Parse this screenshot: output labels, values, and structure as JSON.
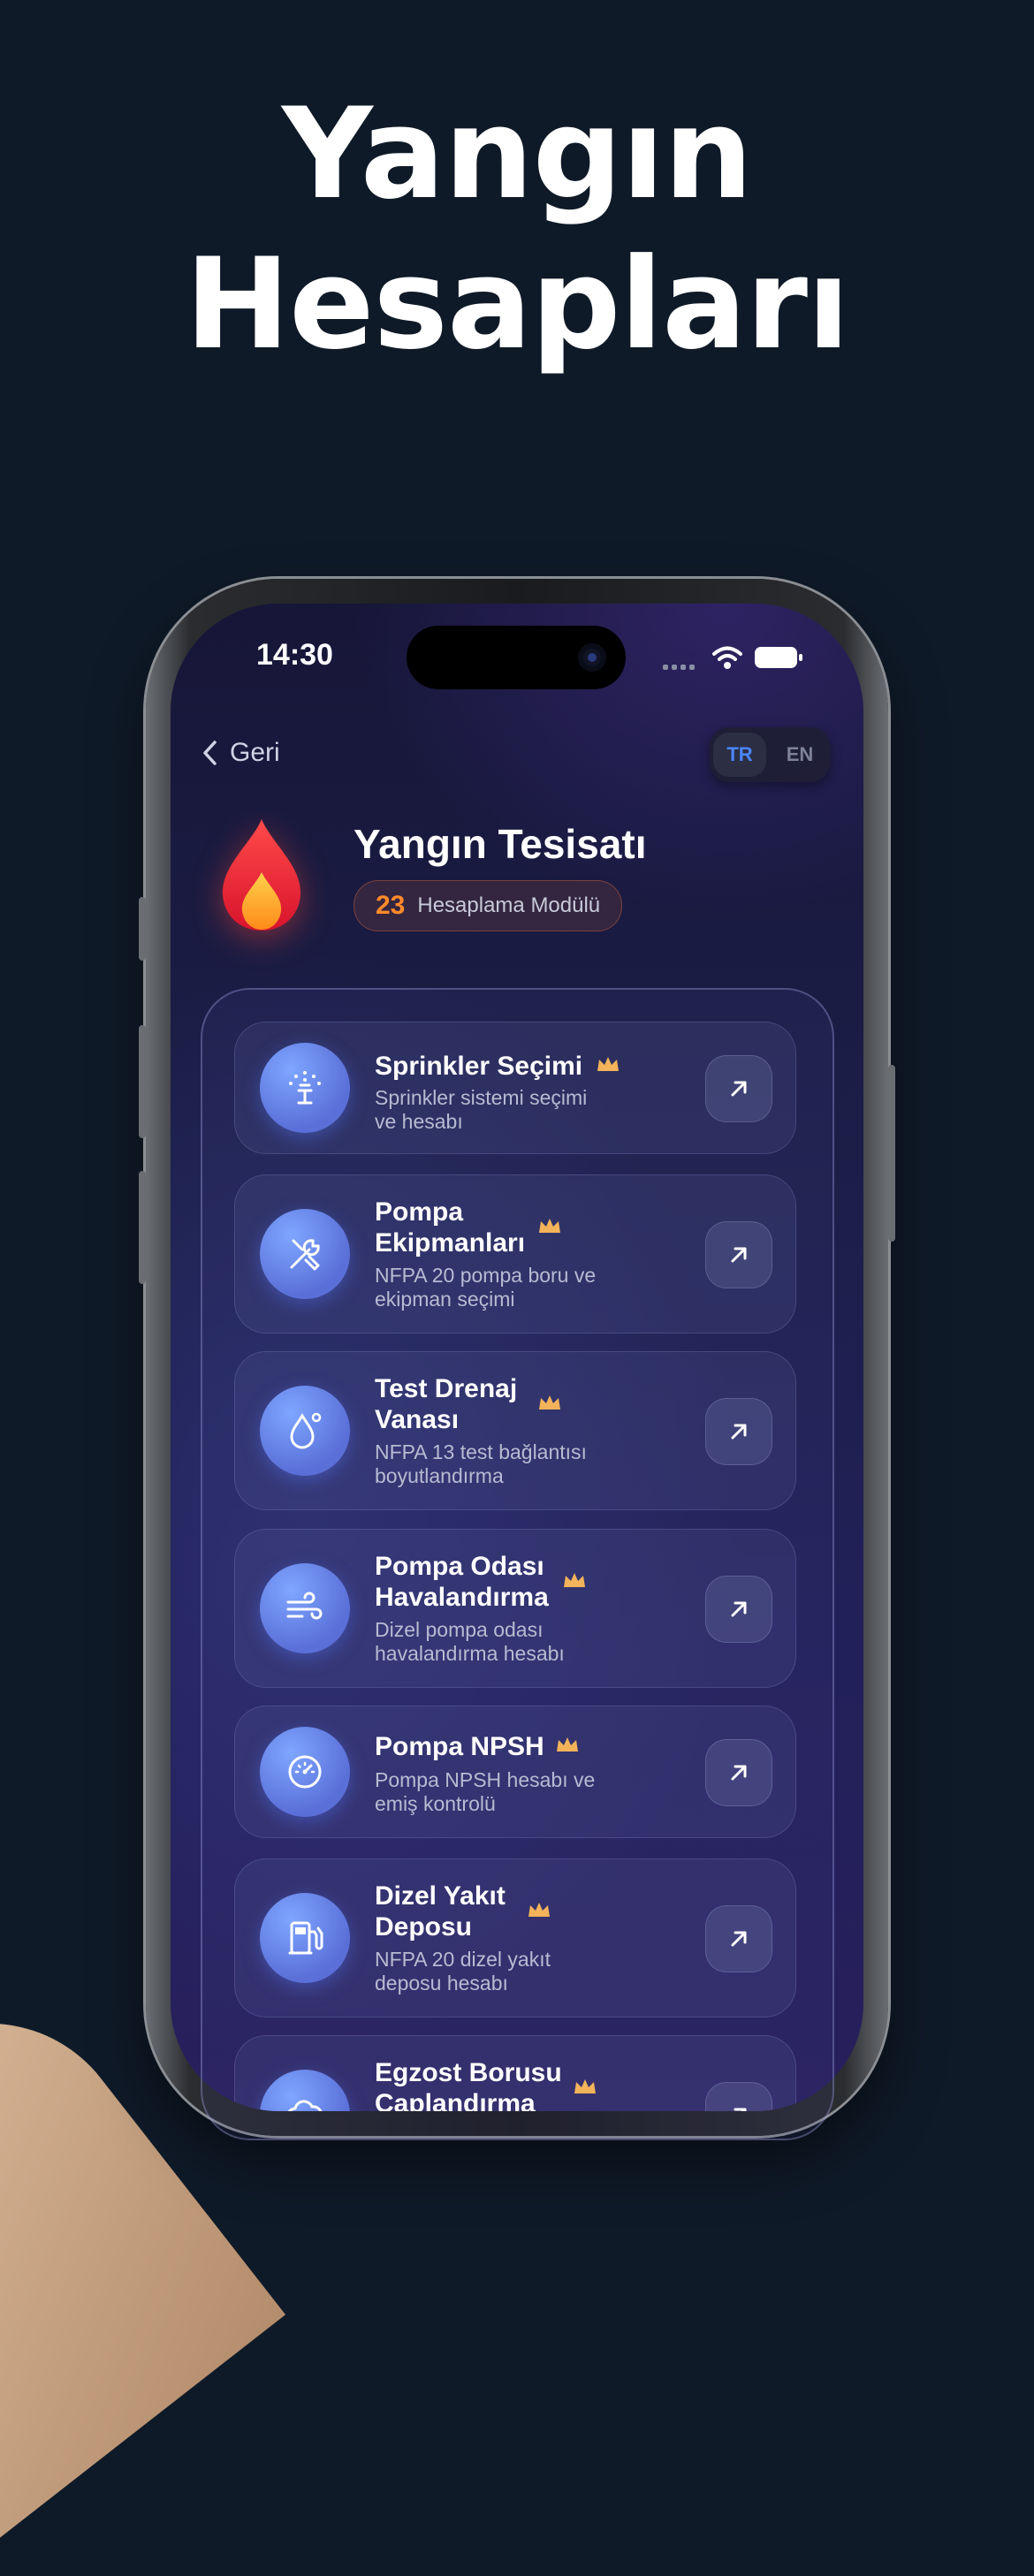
{
  "hero": {
    "line1": "Yangın",
    "line2": "Hesapları"
  },
  "status_bar": {
    "time": "14:30"
  },
  "header": {
    "back_label": "Geri",
    "lang_tr": "TR",
    "lang_en": "EN"
  },
  "app": {
    "title": "Yangın Tesisatı",
    "module_count": "23",
    "module_label": "Hesaplama Modülü"
  },
  "colors": {
    "accent_orange": "#ff8a2a",
    "accent_blue": "#4a86ff",
    "crown_gold": "#f2b35a"
  },
  "cards": [
    {
      "title": "Sprinkler Seçimi",
      "desc": "Sprinkler sistemi seçimi ve hesabı",
      "icon": "sprinkler-icon"
    },
    {
      "title": "Pompa Ekipmanları",
      "desc": "NFPA 20 pompa boru ve ekipman seçimi",
      "icon": "tools-icon"
    },
    {
      "title": "Test Drenaj Vanası",
      "desc": "NFPA 13 test bağlantısı boyutlandırma",
      "icon": "water-drop-icon"
    },
    {
      "title": "Pompa Odası Havalandırma",
      "desc": "Dizel pompa odası havalandırma hesabı",
      "icon": "wind-icon"
    },
    {
      "title": "Pompa NPSH",
      "desc": "Pompa NPSH hesabı ve emiş kontrolü",
      "icon": "gauge-icon"
    },
    {
      "title": "Dizel Yakıt Deposu",
      "desc": "NFPA 20 dizel yakıt deposu hesabı",
      "icon": "fuel-pump-icon"
    },
    {
      "title": "Egzost Borusu Çaplandırma",
      "desc": "",
      "icon": "cloud-icon"
    }
  ]
}
